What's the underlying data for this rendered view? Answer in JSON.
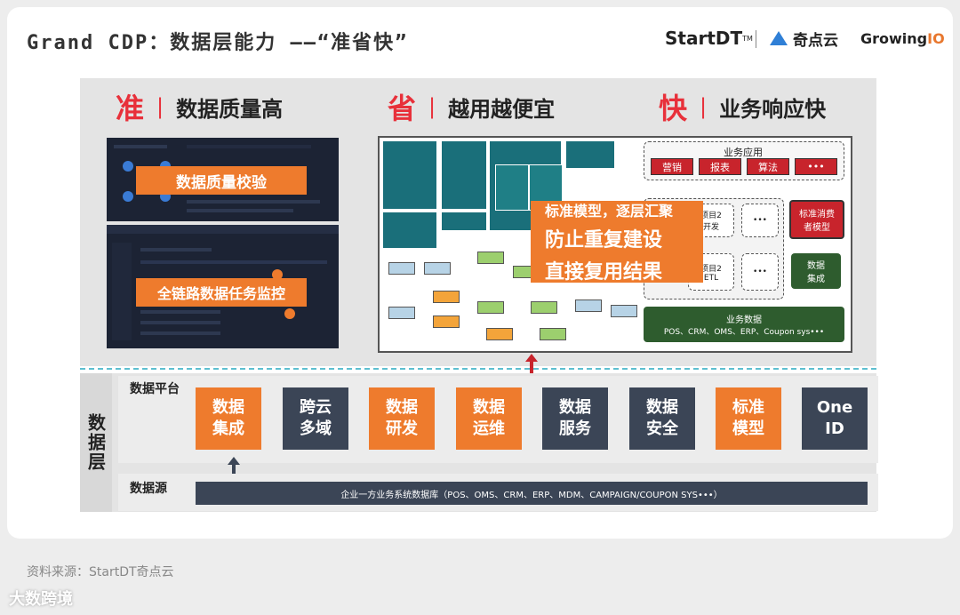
{
  "title": "Grand CDP：数据层能力 ——“准省快”",
  "logos": {
    "startdt": "StartDT",
    "startdt_tm": "TM",
    "qidianyun": "奇点云",
    "growingio_a": "Growing",
    "growingio_b": "IO"
  },
  "pillars": [
    {
      "char": "准",
      "text": "数据质量高"
    },
    {
      "char": "省",
      "text": "越用越便宜"
    },
    {
      "char": "快",
      "text": "业务响应快"
    }
  ],
  "overlays": {
    "quality_check": "数据质量校验",
    "task_monitor": "全链路数据任务监控"
  },
  "callout": {
    "line1": "标准模型，逐层汇聚",
    "line2": "防止重复建设",
    "line3": "直接复用结果"
  },
  "business_diagram": {
    "apps_title": "业务应用",
    "apps": [
      "营销",
      "报表",
      "算法",
      "•••"
    ],
    "project_dev": "项目2\n开发",
    "dots": "•••",
    "standard_model": "标准消费\n者模型",
    "project_etl": "项目2\nETL",
    "data_integration": "数据\n集成",
    "biz_data_title": "业务数据",
    "biz_data_items": "POS、CRM、OMS、ERP、Coupon sys•••"
  },
  "platform": {
    "label": "数据平台",
    "modules": [
      {
        "text": "数据\n集成",
        "style": "o"
      },
      {
        "text": "跨云\n多域",
        "style": "d"
      },
      {
        "text": "数据\n研发",
        "style": "o"
      },
      {
        "text": "数据\n运维",
        "style": "o"
      },
      {
        "text": "数据\n服务",
        "style": "d"
      },
      {
        "text": "数据\n安全",
        "style": "d"
      },
      {
        "text": "标准\n模型",
        "style": "o"
      },
      {
        "text": "One\nID",
        "style": "d"
      }
    ]
  },
  "layer_label": "数据层",
  "source": {
    "label": "数据源",
    "bar": "企业一方业务系统数据库（POS、OMS、CRM、ERP、MDM、CAMPAIGN/COUPON SYS•••）"
  },
  "footer": {
    "source_text": "资料来源：StartDT奇点云",
    "watermark": "大数跨境"
  },
  "colors": {
    "accent_red": "#e8303a",
    "orange": "#ee7b2d",
    "dark_slate": "#3b4556",
    "teal": "#1f7f86",
    "dark_red": "#c8242c",
    "dark_green": "#2e5c2e"
  }
}
